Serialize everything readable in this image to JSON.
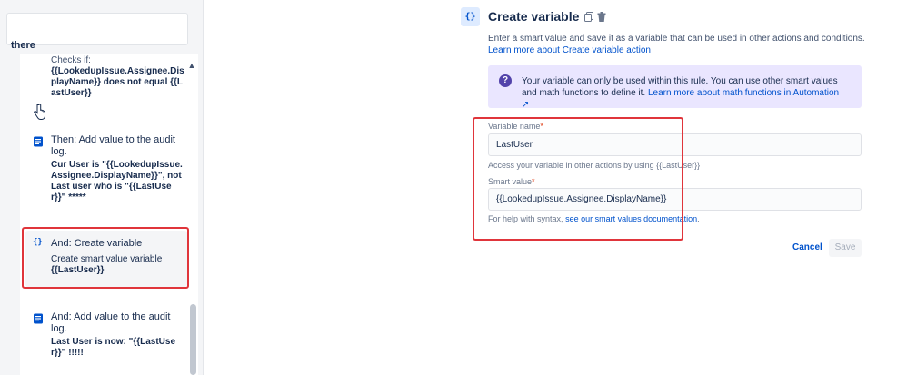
{
  "rule_panel": {
    "top_text": "there",
    "condition": {
      "prefix": "Checks if:",
      "expression": "{{LookedupIssue.Assignee.DisplayName}} does not equal {{LastUser}}"
    },
    "steps": [
      {
        "title": "Then: Add value to the audit log.",
        "detail": "Cur User is \"{{LookedupIssue.Assignee.DisplayName}}\", not Last user who is \"{{LastUser}}\" *****",
        "icon": "audit-log-icon"
      },
      {
        "title": "And: Create variable",
        "detail_plain": "Create smart value variable",
        "detail": "{{LastUser}}",
        "icon": "braces-icon",
        "icon_glyph": "{}"
      },
      {
        "title": "And: Add value to the audit log.",
        "detail": "Last User is now: \"{{LastUser}}\" !!!!!",
        "icon": "audit-log-icon"
      }
    ]
  },
  "config": {
    "icon_glyph": "{}",
    "title": "Create variable",
    "description": "Enter a smart value and save it as a variable that can be used in other actions and conditions.",
    "description_link": "Learn more about Create variable action",
    "info": {
      "text": "Your variable can only be used within this rule. You can use other smart values and math functions to define it.",
      "link": "Learn more about math functions in Automation ↗"
    },
    "variable_name": {
      "label": "Variable name",
      "required_mark": "*",
      "value": "LastUser",
      "help": "Access your variable in other actions by using {{LastUser}}"
    },
    "smart_value": {
      "label": "Smart value",
      "required_mark": "*",
      "value": "{{LookedupIssue.Assignee.DisplayName}}",
      "help_prefix": "For help with syntax,",
      "help_link": "see our smart values documentation",
      "help_suffix": "."
    },
    "buttons": {
      "cancel": "Cancel",
      "save": "Save"
    }
  },
  "colors": {
    "accent": "#0052cc",
    "highlight_border": "#e0353b",
    "info_bg": "#eae6ff"
  }
}
